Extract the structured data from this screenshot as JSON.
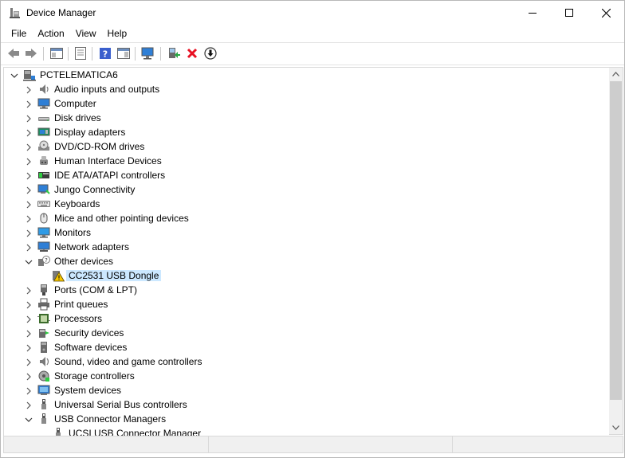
{
  "window": {
    "title": "Device Manager",
    "controls": {
      "minimize": "—",
      "maximize": "☐",
      "close": "✕"
    }
  },
  "menu": [
    "File",
    "Action",
    "View",
    "Help"
  ],
  "toolbar": {
    "buttons": [
      "back-icon",
      "forward-icon",
      "properties-pane-icon",
      "document-icon",
      "help-icon",
      "view-pane-icon",
      "monitor-scan-icon",
      "update-driver-icon",
      "uninstall-icon",
      "download-icon"
    ]
  },
  "tree": {
    "root": "PCTELEMATICA6",
    "categories": [
      {
        "label": "Audio inputs and outputs",
        "icon": "speaker-icon",
        "expanded": false
      },
      {
        "label": "Computer",
        "icon": "computer-icon",
        "expanded": false
      },
      {
        "label": "Disk drives",
        "icon": "disk-drive-icon",
        "expanded": false
      },
      {
        "label": "Display adapters",
        "icon": "display-adapter-icon",
        "expanded": false
      },
      {
        "label": "DVD/CD-ROM drives",
        "icon": "dvd-drive-icon",
        "expanded": false
      },
      {
        "label": "Human Interface Devices",
        "icon": "hid-icon",
        "expanded": false
      },
      {
        "label": "IDE ATA/ATAPI controllers",
        "icon": "ide-controller-icon",
        "expanded": false
      },
      {
        "label": "Jungo Connectivity",
        "icon": "jungo-icon",
        "expanded": false
      },
      {
        "label": "Keyboards",
        "icon": "keyboard-icon",
        "expanded": false
      },
      {
        "label": "Mice and other pointing devices",
        "icon": "mouse-icon",
        "expanded": false
      },
      {
        "label": "Monitors",
        "icon": "monitor-icon",
        "expanded": false
      },
      {
        "label": "Network adapters",
        "icon": "network-adapter-icon",
        "expanded": false
      },
      {
        "label": "Other devices",
        "icon": "unknown-device-icon",
        "expanded": true,
        "children": [
          {
            "label": "CC2531 USB Dongle",
            "icon": "warning-device-icon",
            "selected": true
          }
        ]
      },
      {
        "label": "Ports (COM & LPT)",
        "icon": "port-icon",
        "expanded": false
      },
      {
        "label": "Print queues",
        "icon": "printer-icon",
        "expanded": false
      },
      {
        "label": "Processors",
        "icon": "processor-icon",
        "expanded": false
      },
      {
        "label": "Security devices",
        "icon": "security-device-icon",
        "expanded": false
      },
      {
        "label": "Software devices",
        "icon": "software-device-icon",
        "expanded": false
      },
      {
        "label": "Sound, video and game controllers",
        "icon": "sound-icon",
        "expanded": false
      },
      {
        "label": "Storage controllers",
        "icon": "storage-controller-icon",
        "expanded": false
      },
      {
        "label": "System devices",
        "icon": "system-device-icon",
        "expanded": false
      },
      {
        "label": "Universal Serial Bus controllers",
        "icon": "usb-icon",
        "expanded": false
      },
      {
        "label": "USB Connector Managers",
        "icon": "usb-connector-icon",
        "expanded": true,
        "children": [
          {
            "label": "UCSI USB Connector Manager",
            "icon": "usb-connector-icon",
            "selected": false
          }
        ]
      }
    ]
  },
  "colors": {
    "selection": "#cce8ff",
    "scroll_thumb": "#cdcdcd",
    "warning": "#f7c600",
    "uninstall_red": "#e81123"
  }
}
